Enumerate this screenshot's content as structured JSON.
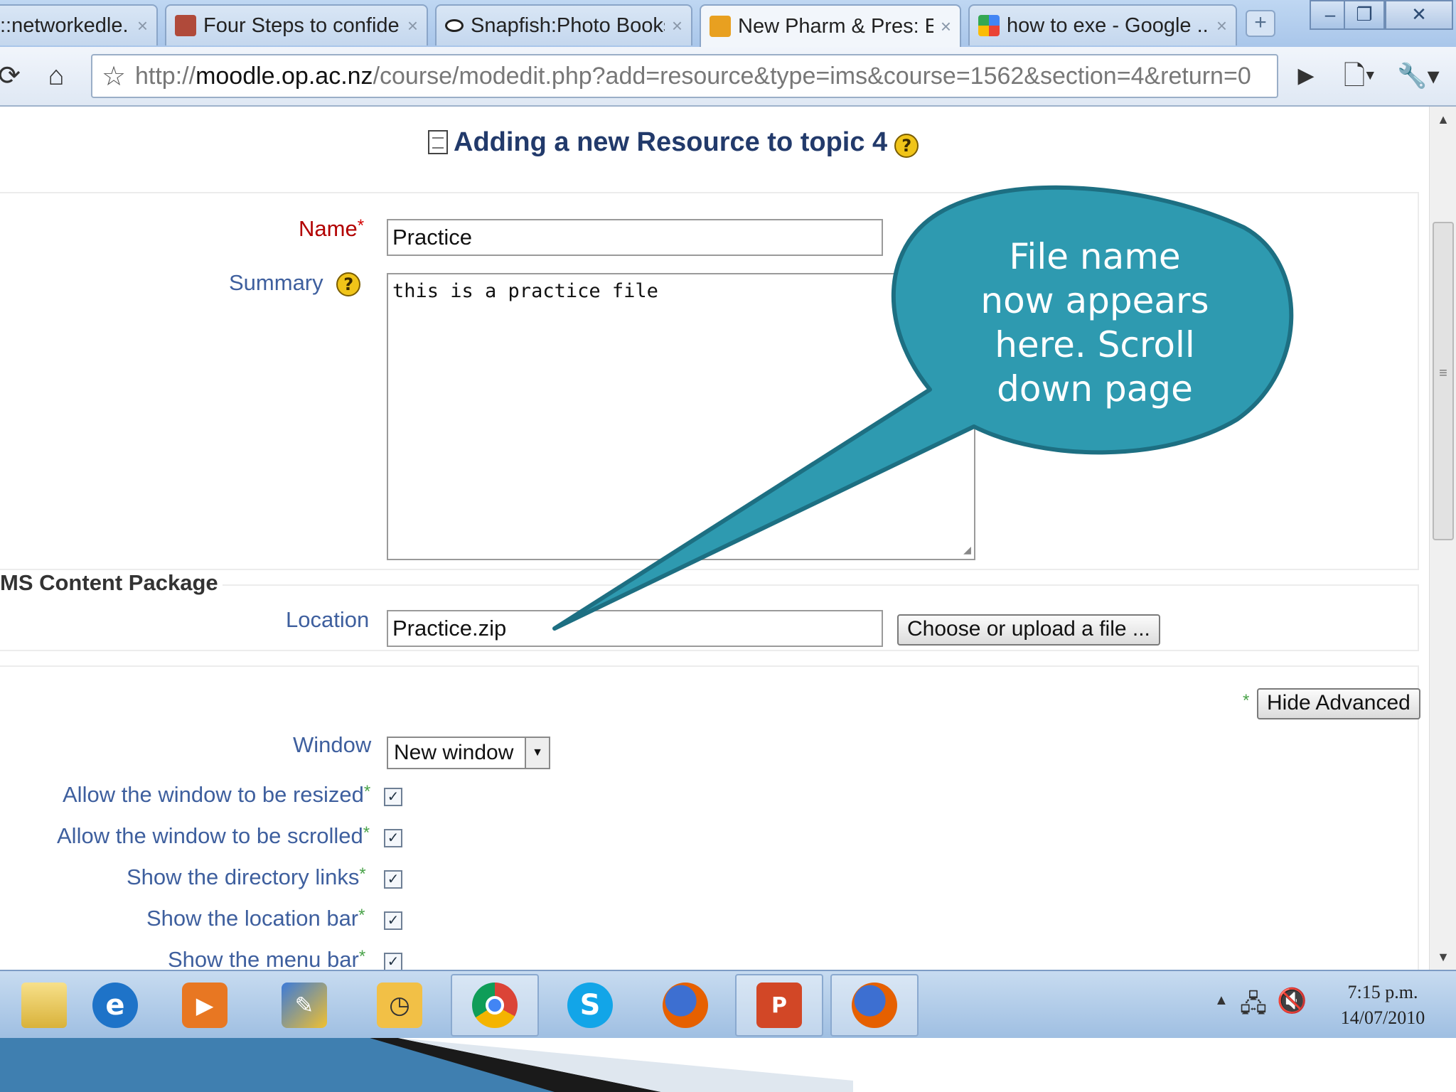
{
  "browser": {
    "tabs": [
      {
        "label": "::networkedle...",
        "active": false
      },
      {
        "label": "Four Steps to confide...",
        "active": false
      },
      {
        "label": "Snapfish:Photo Books",
        "active": false
      },
      {
        "label": "New Pharm & Pres: E...",
        "active": true
      },
      {
        "label": "how to exe - Google ...",
        "active": false
      }
    ],
    "tab_close": "×",
    "new_tab": "+",
    "window_controls": {
      "minimize": "–",
      "restore": "❐",
      "close": "✕"
    },
    "url_scheme": "http://",
    "url_host": "moodle.op.ac.nz",
    "url_path": "/course/modedit.php?add=resource&type=ims&course=1562&section=4&return=0"
  },
  "form": {
    "heading": "Adding a new Resource to topic 4",
    "help_glyph": "?",
    "name_label": "Name",
    "name_value": "Practice",
    "summary_label": "Summary",
    "summary_value": "this is a practice file",
    "section_legend": "MS Content Package",
    "location_label": "Location",
    "location_value": "Practice.zip",
    "choose_button": "Choose or upload a file ...",
    "hide_advanced_button": "Hide Advanced",
    "window_label": "Window",
    "window_value": "New window",
    "options": [
      {
        "label": "Allow the window to be resized",
        "checked": true
      },
      {
        "label": "Allow the window to be scrolled",
        "checked": true
      },
      {
        "label": "Show the directory links",
        "checked": true
      },
      {
        "label": "Show the location bar",
        "checked": true
      },
      {
        "label": "Show the menu bar",
        "checked": true
      }
    ],
    "required_star": "*",
    "check_glyph": "✓"
  },
  "callout": {
    "lines": [
      "File name",
      "now appears",
      "here. Scroll",
      "down page"
    ],
    "fill_color": "#2e9ab0",
    "border_color": "#1d6f82"
  },
  "taskbar": {
    "apps": [
      "explorer-folder-icon",
      "internet-explorer-icon",
      "media-player-icon",
      "pen-tool-icon",
      "outlook-icon",
      "chrome-icon",
      "skype-icon",
      "firefox-icon",
      "powerpoint-icon",
      "firefox-icon"
    ],
    "clock_time": "7:15 p.m.",
    "clock_date": "14/07/2010"
  }
}
